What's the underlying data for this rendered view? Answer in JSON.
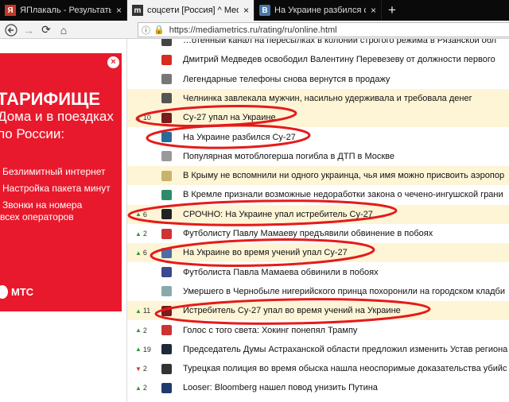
{
  "tabs": [
    {
      "label": "ЯПлакаль - Результаты поиска",
      "icon": "yaplakal-icon",
      "active": false
    },
    {
      "label": "соцсети [Россия] ^ MediaMetrics",
      "icon": "mediametrics-icon",
      "active": true
    },
    {
      "label": "На Украине разбился самолет",
      "icon": "vk-icon",
      "active": false
    }
  ],
  "url": "https://mediametrics.ru/rating/ru/online.html",
  "ad": {
    "title": "ТАРИФИЩЕ",
    "sub1": "Дома и в поездках",
    "sub2": "по России:",
    "items": [
      "Безлимитный интернет",
      "Настройка пакета минут",
      "Звонки на номера",
      "всех операторов"
    ],
    "logo": "МТС"
  },
  "rows": [
    {
      "rank": "",
      "dir": "",
      "icon": "ugc-icon",
      "icolor": "#444",
      "title": "…отенный канал на пересылках в колонии строгого режима в Рязанской обл",
      "hl": false
    },
    {
      "rank": "",
      "dir": "",
      "icon": "u-icon",
      "icolor": "#d62d20",
      "title": "Дмитрий Медведев освободил Валентину Перевезеву от должности первого",
      "hl": false
    },
    {
      "rank": "",
      "dir": "",
      "icon": "rg-icon",
      "icolor": "#777",
      "title": "Легендарные телефоны снова вернутся в продажу",
      "hl": false
    },
    {
      "rank": "",
      "dir": "",
      "icon": "grid-icon",
      "icolor": "#555",
      "title": "Челнинка завлекала мужчин, насильно удерживала и требовала денег",
      "hl": true
    },
    {
      "rank": "10",
      "dir": "up",
      "icon": "r-icon",
      "icolor": "#7a1c1c",
      "title": "Су-27 упал на Украине",
      "hl": true
    },
    {
      "rank": "",
      "dir": "",
      "icon": "circle-icon",
      "icolor": "#2a6a9a",
      "title": "На Украине разбился Су-27",
      "hl": false
    },
    {
      "rank": "",
      "dir": "",
      "icon": "mk-icon",
      "icolor": "#999",
      "title": "Популярная мотоблогерша погибла в ДТП в Москве",
      "hl": false
    },
    {
      "rank": "",
      "dir": "",
      "icon": "paper-icon",
      "icolor": "#c9b26b",
      "title": "В Крыму не вспомнили ни одного украинца, чья имя можно присвоить аэропор",
      "hl": true
    },
    {
      "rank": "",
      "dir": "",
      "icon": "triangle-icon",
      "icolor": "#2e8b6a",
      "title": "В Кремле признали возможные недоработки закона о чечено-ингушской грани",
      "hl": false
    },
    {
      "rank": "6",
      "dir": "up",
      "icon": "bars-icon",
      "icolor": "#222",
      "title": "СРОЧНО: На Украине упал истребитель Су-27",
      "hl": true
    },
    {
      "rank": "2",
      "dir": "up",
      "icon": "m-icon",
      "icolor": "#c33",
      "title": "Футболисту Павлу Мамаеву предъявили обвинение в побоях",
      "hl": false
    },
    {
      "rank": "6",
      "dir": "up",
      "icon": "globe-icon",
      "icolor": "#4a6fa5",
      "title": "На Украине во время учений упал Су-27",
      "hl": true
    },
    {
      "rank": "",
      "dir": "",
      "icon": "iz-icon",
      "icolor": "#3b4a8a",
      "title": "Футболиста Павла Мамаева обвинили в побоях",
      "hl": false
    },
    {
      "rank": "",
      "dir": "",
      "icon": "wave-icon",
      "icolor": "#8aa",
      "title": "Умершего в Чернобыле нигерийского принца похоронили на городском кладби",
      "hl": false
    },
    {
      "rank": "11",
      "dir": "up",
      "icon": "r-icon",
      "icolor": "#7a1c1c",
      "title": "Истребитель Су-27 упал во время учений на Украине",
      "hl": true
    },
    {
      "rank": "2",
      "dir": "up",
      "icon": "gamma-icon",
      "icolor": "#c33",
      "title": "Голос с того света: Хокинг понепял Трампу",
      "hl": false
    },
    {
      "rank": "19",
      "dir": "up",
      "icon": "rbc-icon",
      "icolor": "#1e2a3a",
      "title": "Председатель Думы Астраханской области предложил изменить Устав региона",
      "hl": false
    },
    {
      "rank": "2",
      "dir": "down",
      "icon": "star-icon",
      "icolor": "#333",
      "title": "Турецкая полиция во время обыска нашла неоспоримые доказательства убийс",
      "hl": false
    },
    {
      "rank": "2",
      "dir": "up",
      "icon": "square-icon",
      "icolor": "#1f3a6e",
      "title": "Looser: Bloomberg нашел повод унизить Путина",
      "hl": false
    }
  ]
}
